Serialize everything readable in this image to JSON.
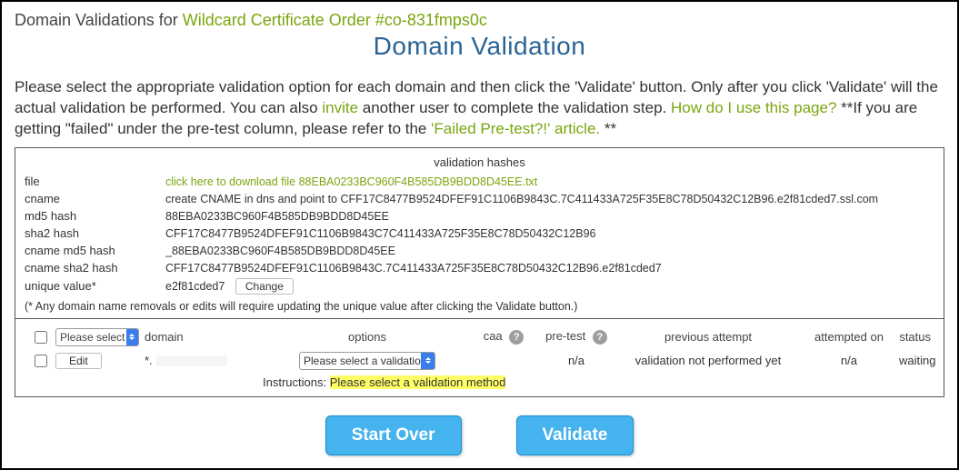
{
  "breadcrumb": {
    "prefix": "Domain Validations for ",
    "order": "Wildcard Certificate Order #co-831fmps0c"
  },
  "title": "Domain Validation",
  "intro": {
    "p1a": "Please select the appropriate validation option for each domain and then click the 'Validate' button. Only after you click 'Validate' will the actual validation be performed. You can also ",
    "invite": "invite",
    "p1b": " another user to complete the validation step. ",
    "howlink": "How do I use this page?",
    "p1c": " **If you are getting \"failed\" under the pre-test column, please refer to the ",
    "failed_link": "'Failed Pre-test?!' article.",
    "p1d": " **"
  },
  "hashes": {
    "title": "validation hashes",
    "file_label": "file",
    "file_link": "click here to download file 88EBA0233BC960F4B585DB9BDD8D45EE.txt",
    "cname_label": "cname",
    "cname_value": "create CNAME in dns and point to CFF17C8477B9524DFEF91C1106B9843C.7C411433A725F35E8C78D50432C12B96.e2f81cded7.ssl.com",
    "md5_label": "md5 hash",
    "md5_value": "88EBA0233BC960F4B585DB9BDD8D45EE",
    "sha2_label": "sha2 hash",
    "sha2_value": "CFF17C8477B9524DFEF91C1106B9843C7C411433A725F35E8C78D50432C12B96",
    "cname_md5_label": "cname md5 hash",
    "cname_md5_value": "_88EBA0233BC960F4B585DB9BDD8D45EE",
    "cname_sha2_label": "cname sha2 hash",
    "cname_sha2_value": "CFF17C8477B9524DFEF91C1106B9843C.7C411433A725F35E8C78D50432C12B96.e2f81cded7",
    "unique_label": "unique value*",
    "unique_value": "e2f81cded7",
    "change": "Change",
    "note": "(* Any domain name removals or edits will require updating the unique value after clicking the Validate button.)"
  },
  "table": {
    "top_select": "Please select a",
    "headers": {
      "domain": "domain",
      "options": "options",
      "caa": "caa",
      "pretest": "pre-test",
      "prev": "previous attempt",
      "attempted": "attempted on",
      "status": "status"
    },
    "row": {
      "edit": "Edit",
      "domain_prefix": "*.",
      "option_select": "Please select a validation",
      "pretest": "n/a",
      "prev": "validation not performed yet",
      "attempted": "n/a",
      "status": "waiting"
    },
    "instructions_label": "Instructions: ",
    "instructions_hi": "Please select a validation method"
  },
  "buttons": {
    "start_over": "Start Over",
    "validate": "Validate"
  }
}
